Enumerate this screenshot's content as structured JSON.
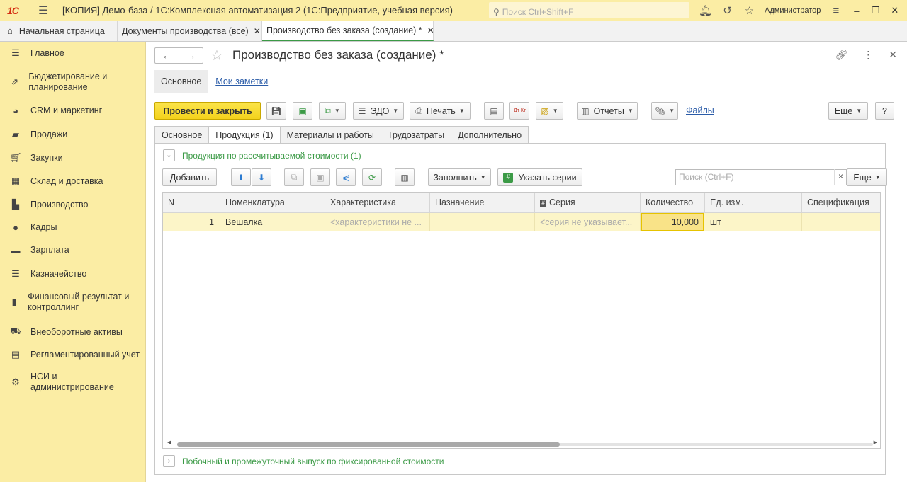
{
  "app": {
    "logo": "1С",
    "title": "[КОПИЯ] Демо-база / 1С:Комплексная автоматизация 2  (1С:Предприятие, учебная версия)",
    "search_placeholder": "Поиск Ctrl+Shift+F",
    "user": "Администратор"
  },
  "tabs": [
    {
      "label": "Начальная страница"
    },
    {
      "label": "Документы производства (все)"
    },
    {
      "label": "Производство без заказа (создание) *"
    }
  ],
  "sidebar": {
    "items": [
      {
        "label": "Главное",
        "icon": "menu-icon"
      },
      {
        "label": "Бюджетирование и планирование",
        "icon": "chart-icon"
      },
      {
        "label": "CRM и маркетинг",
        "icon": "pie-icon"
      },
      {
        "label": "Продажи",
        "icon": "bag-icon"
      },
      {
        "label": "Закупки",
        "icon": "cart-icon"
      },
      {
        "label": "Склад и доставка",
        "icon": "warehouse-icon"
      },
      {
        "label": "Производство",
        "icon": "factory-icon"
      },
      {
        "label": "Кадры",
        "icon": "person-icon"
      },
      {
        "label": "Зарплата",
        "icon": "money-icon"
      },
      {
        "label": "Казначейство",
        "icon": "coins-icon"
      },
      {
        "label": "Финансовый результат и контроллинг",
        "icon": "bar-chart-icon"
      },
      {
        "label": "Внеоборотные активы",
        "icon": "truck-icon"
      },
      {
        "label": "Регламентированный учет",
        "icon": "document-icon"
      },
      {
        "label": "НСИ и администрирование",
        "icon": "gear-icon"
      }
    ]
  },
  "document": {
    "title": "Производство без заказа (создание) *",
    "subtabs": [
      "Основное",
      "Мои заметки"
    ]
  },
  "toolbar": {
    "post_close": "Провести и закрыть",
    "edo": "ЭДО",
    "print": "Печать",
    "reports": "Отчеты",
    "files": "Файлы",
    "more": "Еще",
    "help": "?",
    "dtkt": "Дт Кт"
  },
  "form_tabs": [
    "Основное",
    "Продукция (1)",
    "Материалы и работы",
    "Трудозатраты",
    "Дополнительно"
  ],
  "products": {
    "group_title": "Продукция по рассчитываемой стоимости (1)",
    "add": "Добавить",
    "fill": "Заполнить",
    "series": "Указать серии",
    "search_placeholder": "Поиск (Ctrl+F)",
    "clear": "×",
    "more": "Еще",
    "columns": [
      "N",
      "Номенклатура",
      "Характеристика",
      "Назначение",
      "Серия",
      "Количество",
      "Ед. изм.",
      "Спецификация"
    ],
    "rows": [
      {
        "n": "1",
        "item": "Вешалка",
        "characteristic": "<характеристики не ...",
        "purpose": "",
        "series": "<серия не указывает...",
        "qty": "10,000",
        "unit": "шт",
        "spec": ""
      }
    ]
  },
  "byproducts": {
    "group_title": "Побочный и промежуточный выпуск по фиксированной стоимости"
  }
}
